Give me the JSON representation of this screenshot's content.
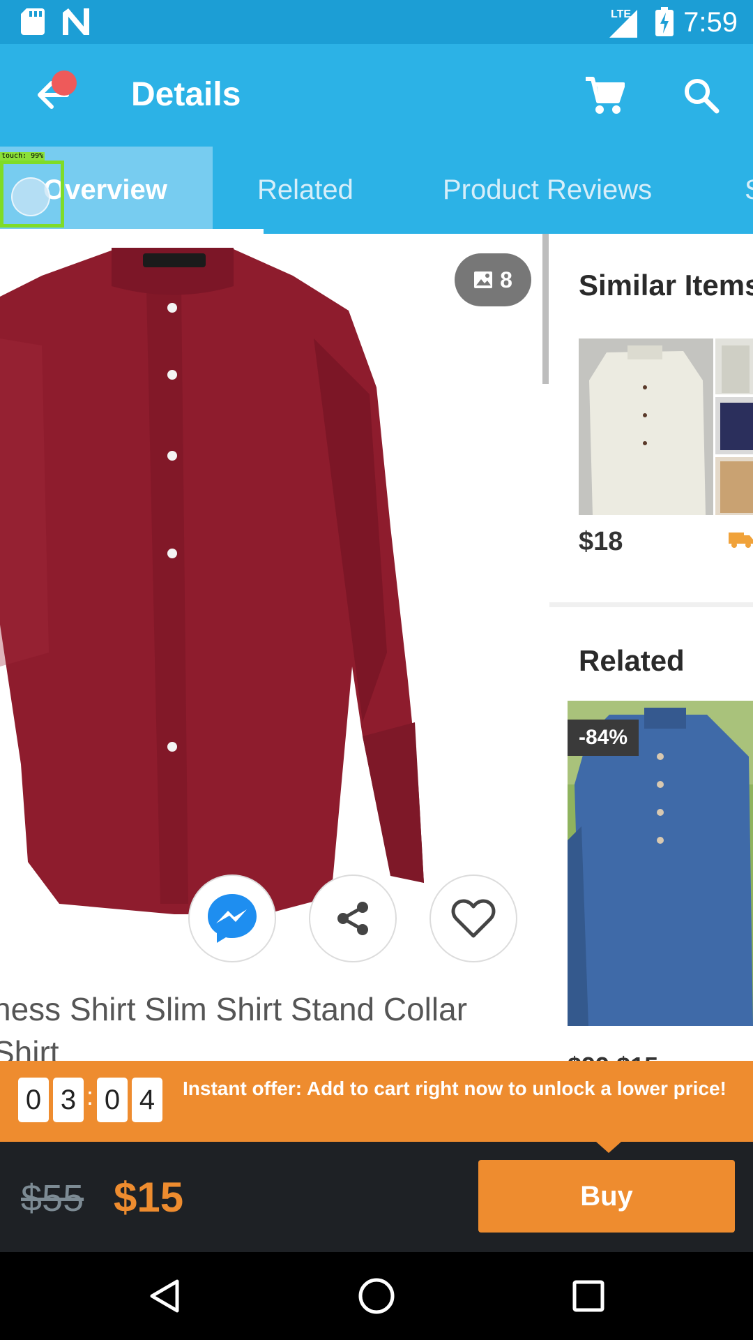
{
  "status_bar": {
    "time": "7:59",
    "network": "LTE",
    "icons": [
      "sd-card-icon",
      "n-notification-icon",
      "signal-icon",
      "battery-charging-icon"
    ]
  },
  "app_bar": {
    "title": "Details",
    "back_icon": "arrow-left-icon",
    "cart_icon": "shopping-cart-icon",
    "search_icon": "search-icon"
  },
  "tabs": [
    {
      "label": "Overview",
      "selected": true
    },
    {
      "label": "Related",
      "selected": false
    },
    {
      "label": "Product Reviews",
      "selected": false
    },
    {
      "label": "S",
      "selected": false
    }
  ],
  "touch_overlay": {
    "label": "touch: 99%"
  },
  "product": {
    "photo_count": "8",
    "title_line1": "ness Shirt Slim Shirt Stand Collar",
    "title_line2": "Shirt"
  },
  "actions": [
    "messenger-icon",
    "share-icon",
    "heart-icon"
  ],
  "similar_items": {
    "title": "Similar Items",
    "price": "$18"
  },
  "related": {
    "title": "Related",
    "discount_badge": "-84%",
    "price_peek": "$99 $15"
  },
  "offer": {
    "timer_digits": [
      "0",
      "3",
      "0",
      "4"
    ],
    "separator": ":",
    "text": "Instant offer: Add to cart right now to unlock a lower price!"
  },
  "purchase": {
    "old_price": "$55",
    "new_price": "$15",
    "buy_label": "Buy"
  },
  "colors": {
    "accent_blue": "#2cb2e6",
    "status_blue": "#1c9ed5",
    "orange": "#ee8c2f",
    "dark_bar": "#1e2125"
  }
}
